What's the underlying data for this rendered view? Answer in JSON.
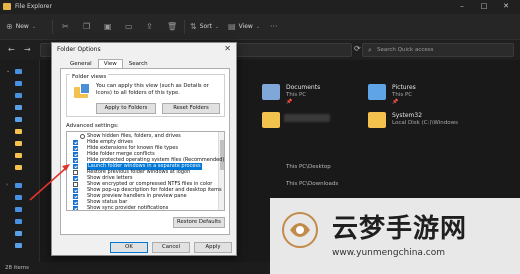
{
  "window": {
    "title": "File Explorer"
  },
  "toolbar": {
    "new_label": "New",
    "sort_label": "Sort",
    "view_label": "View"
  },
  "search": {
    "placeholder": "Search Quick access"
  },
  "content": {
    "tiles": [
      {
        "name": "Documents",
        "sub": "This PC",
        "pin": "📌"
      },
      {
        "name": "Pictures",
        "sub": "This PC",
        "pin": "📌"
      },
      {
        "name": "System32",
        "sub": "Local Disk (C:)\\Windows",
        "pin": ""
      }
    ],
    "paths": [
      "This PC\\Desktop",
      "This PC\\Downloads"
    ]
  },
  "status": {
    "items": "28 items"
  },
  "dialog": {
    "title": "Folder Options",
    "tabs": [
      "General",
      "View",
      "Search"
    ],
    "active_tab": "View",
    "folder_views": {
      "label": "Folder views",
      "description": "You can apply this view (such as Details or Icons) to all folders of this type.",
      "apply_button": "Apply to Folders",
      "reset_button": "Reset Folders"
    },
    "advanced_label": "Advanced settings:",
    "advanced_items": [
      {
        "label": "Show hidden files, folders, and drives",
        "control": "radio",
        "checked": false,
        "selected": false
      },
      {
        "label": "Hide empty drives",
        "control": "checkbox",
        "checked": true,
        "selected": false
      },
      {
        "label": "Hide extensions for known file types",
        "control": "checkbox",
        "checked": true,
        "selected": false
      },
      {
        "label": "Hide folder merge conflicts",
        "control": "checkbox",
        "checked": true,
        "selected": false
      },
      {
        "label": "Hide protected operating system files (Recommended)",
        "control": "checkbox",
        "checked": true,
        "selected": false
      },
      {
        "label": "Launch folder windows in a separate process",
        "control": "checkbox",
        "checked": true,
        "selected": true
      },
      {
        "label": "Restore previous folder windows at logon",
        "control": "checkbox",
        "checked": false,
        "selected": false
      },
      {
        "label": "Show drive letters",
        "control": "checkbox",
        "checked": true,
        "selected": false
      },
      {
        "label": "Show encrypted or compressed NTFS files in color",
        "control": "checkbox",
        "checked": false,
        "selected": false
      },
      {
        "label": "Show pop-up description for folder and desktop items",
        "control": "checkbox",
        "checked": true,
        "selected": false
      },
      {
        "label": "Show preview handlers in preview pane",
        "control": "checkbox",
        "checked": true,
        "selected": false
      },
      {
        "label": "Show status bar",
        "control": "checkbox",
        "checked": true,
        "selected": false
      },
      {
        "label": "Show sync provider notifications",
        "control": "checkbox",
        "checked": true,
        "selected": false
      }
    ],
    "restore_defaults": "Restore Defaults",
    "ok": "OK",
    "cancel": "Cancel",
    "apply": "Apply"
  },
  "watermark": {
    "text": "云梦手游网",
    "url": "www.yunmengchina.com"
  },
  "colors": {
    "accent": "#0078d7",
    "arrow": "#e0332f",
    "folder": "#f3c14d"
  }
}
